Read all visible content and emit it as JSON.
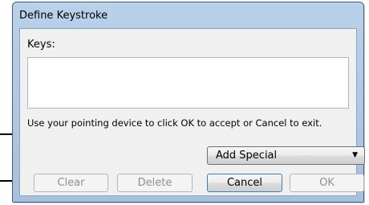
{
  "window": {
    "title": "Define Keystroke"
  },
  "keys": {
    "label": "Keys:",
    "value": ""
  },
  "hint": "Use your pointing device to click OK to accept or Cancel to exit.",
  "add_special": {
    "selected": "Add Special"
  },
  "buttons": {
    "clear": "Clear",
    "delete": "Delete",
    "cancel": "Cancel",
    "ok": "OK"
  },
  "icons": {
    "dropdown_arrow": "▼"
  }
}
